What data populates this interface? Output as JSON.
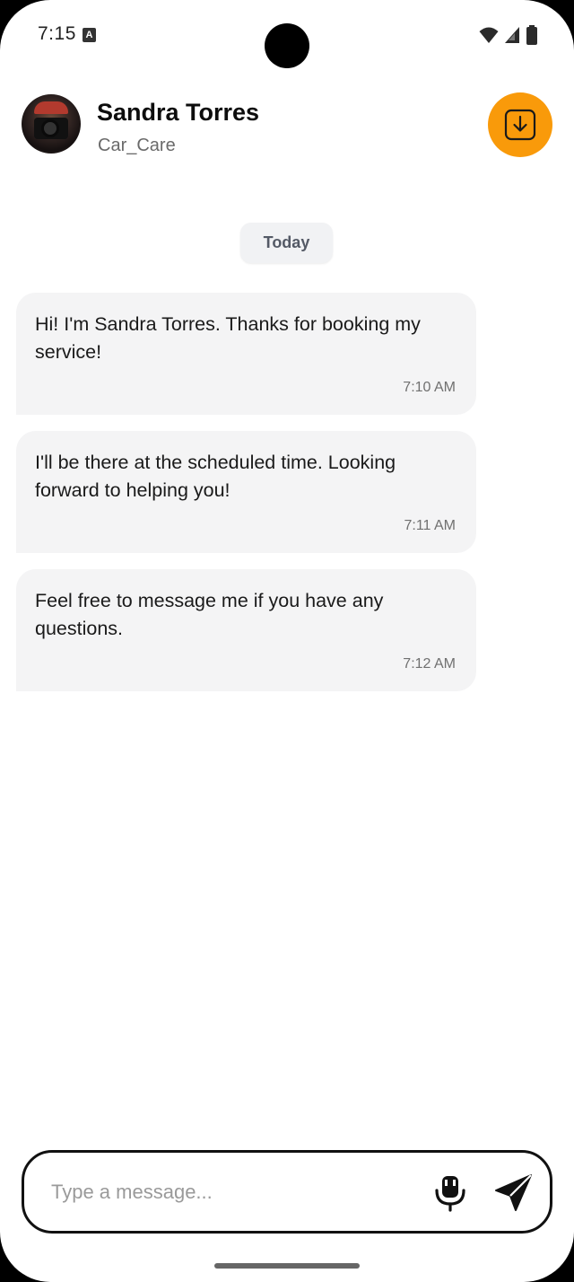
{
  "status_bar": {
    "time": "7:15",
    "notification_icon": "a-badge-icon",
    "icons": [
      "wifi-icon",
      "signal-icon",
      "battery-icon"
    ]
  },
  "header": {
    "name": "Sandra Torres",
    "subtitle": "Car_Care",
    "action_icon": "download-icon",
    "accent_color": "#F99A0A"
  },
  "chat": {
    "date_label": "Today",
    "messages": [
      {
        "text": "Hi! I'm Sandra Torres. Thanks for booking my service!",
        "time": "7:10 AM"
      },
      {
        "text": "I'll be there at the scheduled time. Looking forward to helping you!",
        "time": "7:11 AM"
      },
      {
        "text": "Feel free to message me if you have any questions.",
        "time": "7:12 AM"
      }
    ]
  },
  "composer": {
    "placeholder": "Type a message...",
    "value": "",
    "mic_icon": "microphone-icon",
    "send_icon": "send-icon"
  }
}
